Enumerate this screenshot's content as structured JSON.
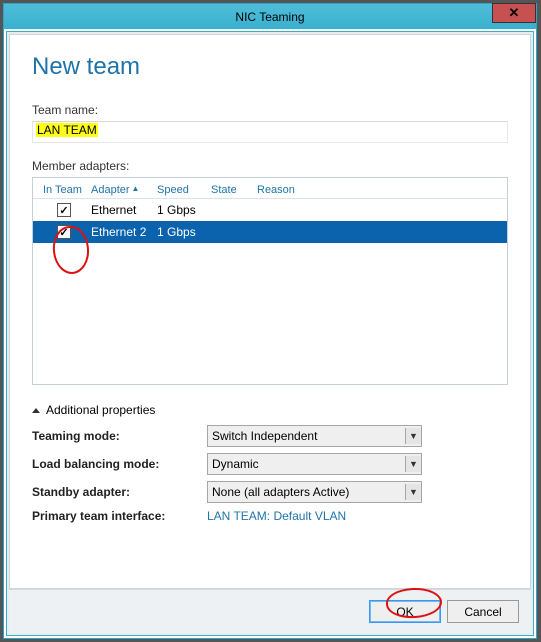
{
  "window": {
    "title": "NIC Teaming"
  },
  "page": {
    "heading": "New team"
  },
  "team_name": {
    "label": "Team name:",
    "value": "LAN TEAM"
  },
  "members": {
    "label": "Member adapters:",
    "columns": {
      "in_team": "In Team",
      "adapter": "Adapter",
      "speed": "Speed",
      "state": "State",
      "reason": "Reason"
    },
    "rows": [
      {
        "checked": true,
        "adapter": "Ethernet",
        "speed": "1 Gbps",
        "state": "",
        "reason": "",
        "selected": false
      },
      {
        "checked": true,
        "adapter": "Ethernet 2",
        "speed": "1 Gbps",
        "state": "",
        "reason": "",
        "selected": true
      }
    ]
  },
  "advanced": {
    "toggle": "Additional properties",
    "teaming_mode": {
      "label": "Teaming mode:",
      "value": "Switch Independent"
    },
    "load_balancing": {
      "label": "Load balancing mode:",
      "value": "Dynamic"
    },
    "standby_adapter": {
      "label": "Standby adapter:",
      "value": "None (all adapters Active)"
    },
    "primary_iface": {
      "label": "Primary team interface:",
      "value": "LAN TEAM: Default VLAN"
    }
  },
  "buttons": {
    "ok": "OK",
    "cancel": "Cancel"
  }
}
